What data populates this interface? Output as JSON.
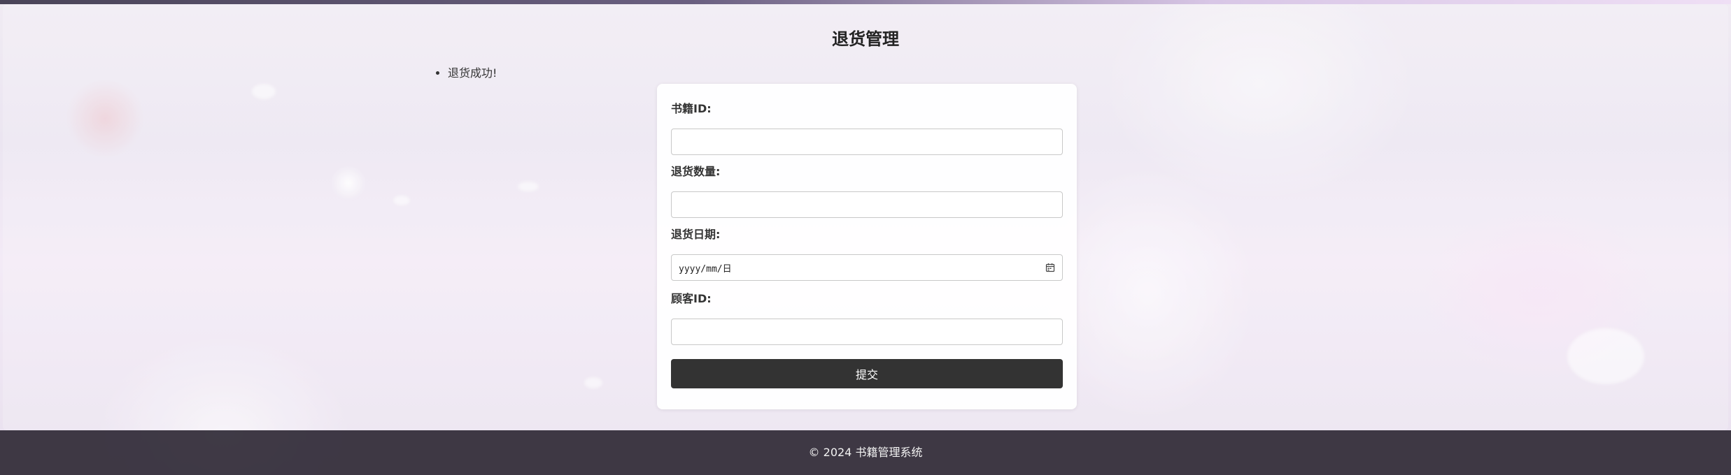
{
  "page": {
    "title": "退货管理"
  },
  "messages": [
    "退货成功!"
  ],
  "form": {
    "book_id": {
      "label": "书籍ID:",
      "value": ""
    },
    "return_quantity": {
      "label": "退货数量:",
      "value": ""
    },
    "return_date": {
      "label": "退货日期:",
      "placeholder": "yyyy/mm/日"
    },
    "customer_id": {
      "label": "顾客ID:",
      "value": ""
    },
    "submit_label": "提交"
  },
  "footer": {
    "text": "© 2024 书籍管理系统"
  },
  "colors": {
    "button_bg": "#333333",
    "footer_bg": "#26202c",
    "card_bg": "#ffffff"
  }
}
